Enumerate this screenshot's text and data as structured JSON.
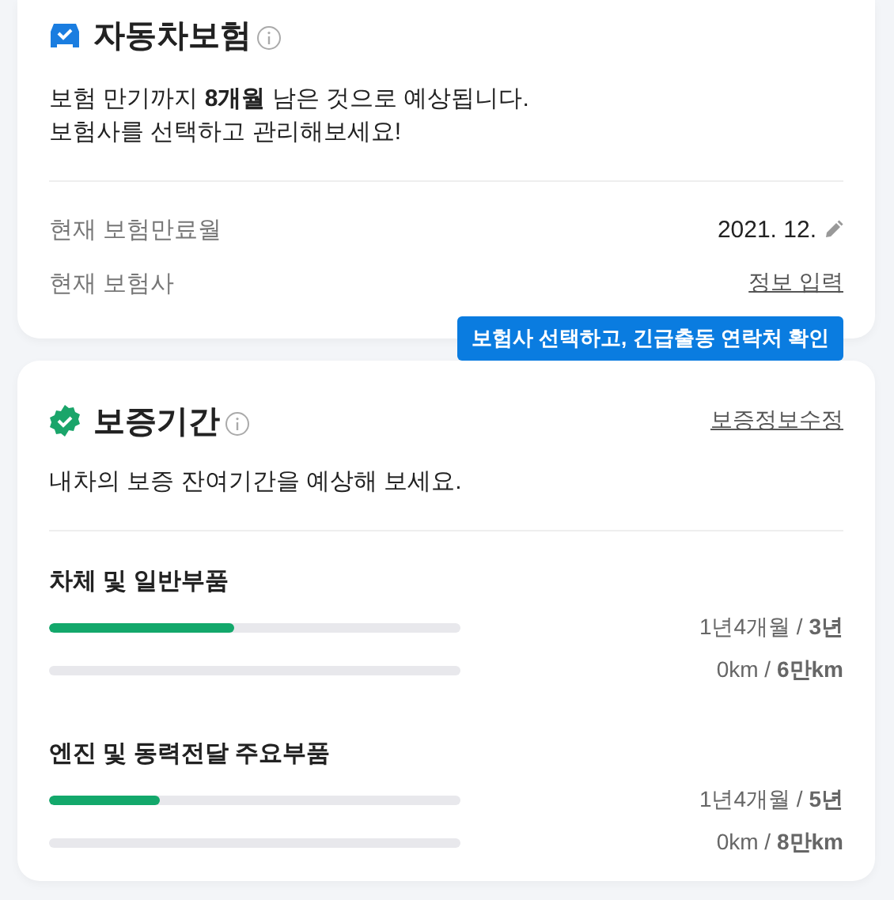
{
  "insurance": {
    "title": "자동차보험",
    "description": [
      "보험 만기까지 **8개월** 남은 것으로 예상됩니다.",
      "보험사를 선택하고 관리해보세요!"
    ],
    "rows": [
      {
        "label": "현재 보험만료월",
        "value": "2021. 12.",
        "kind": "edit"
      },
      {
        "label": "현재 보험사",
        "value": "정보 입력",
        "kind": "link"
      }
    ],
    "tooltip": "**보험사 선택**하고, 긴급출동 연락처 확인"
  },
  "warranty": {
    "title": "보증기간",
    "edit_link": "보증정보수정",
    "description": "내차의 보증 잔여기간을 예상해 보세요.",
    "items": [
      {
        "name": "차체 및 일반부품",
        "bars": [
          {
            "level": 0.45,
            "reading": "1년4개월 / **3년**"
          },
          {
            "level": 0,
            "reading": "0km / **6만km**"
          }
        ]
      },
      {
        "name": "엔진 및 동력전달 주요부품",
        "bars": [
          {
            "level": 0.27,
            "reading": "1년4개월 / **5년**"
          },
          {
            "level": 0,
            "reading": "0km / **8만km**"
          }
        ]
      }
    ]
  }
}
